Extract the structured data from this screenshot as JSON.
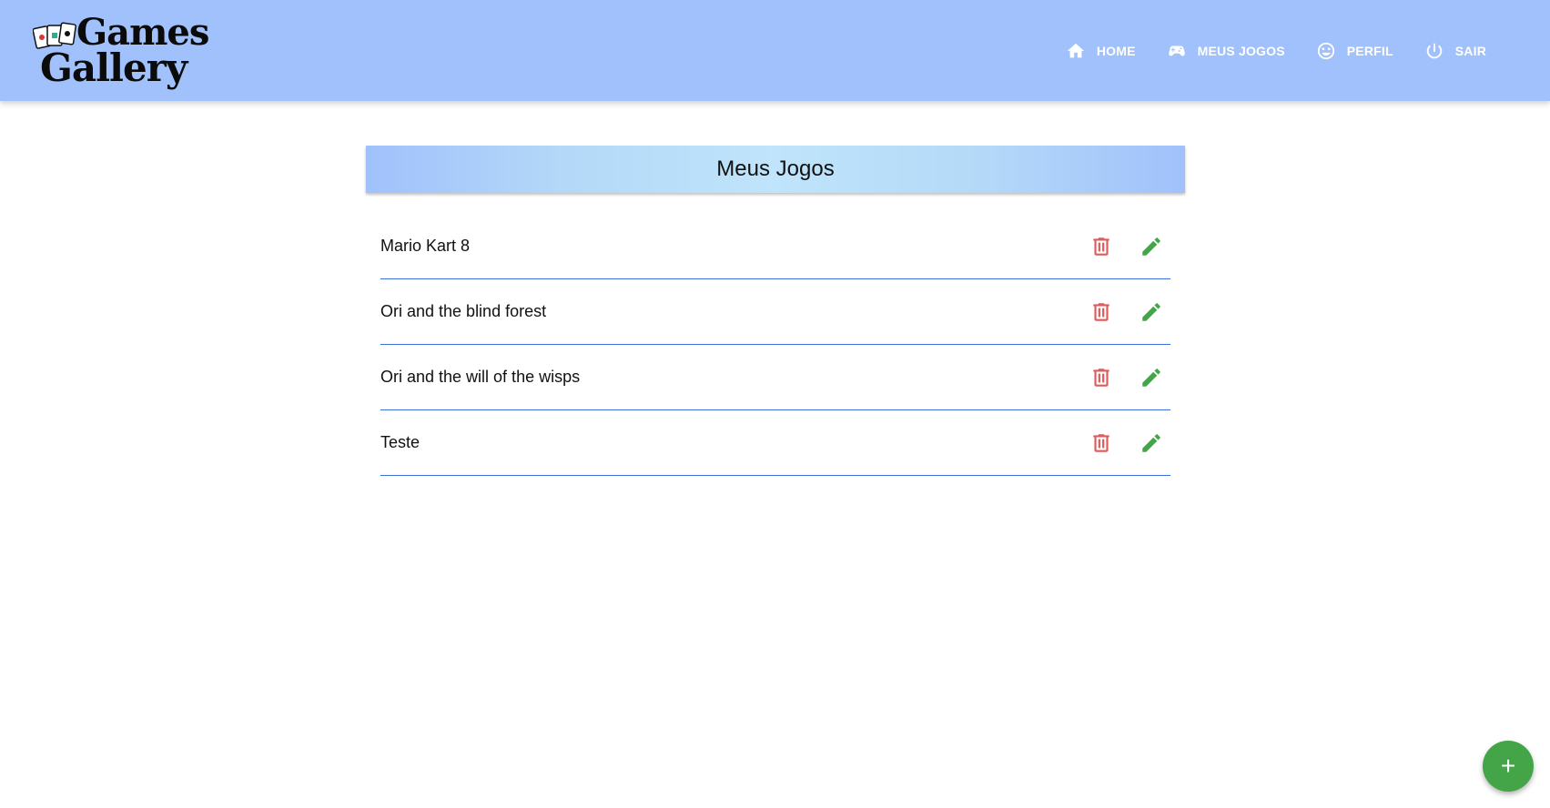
{
  "header": {
    "logo_line1": "Games",
    "logo_line2": "Gallery",
    "nav": [
      {
        "label": "HOME",
        "icon": "home-icon"
      },
      {
        "label": "MEUS JOGOS",
        "icon": "gamepad-icon"
      },
      {
        "label": "PERFIL",
        "icon": "smiley-icon"
      },
      {
        "label": "SAIR",
        "icon": "power-icon"
      }
    ]
  },
  "main": {
    "title": "Meus Jogos",
    "games": [
      {
        "name": "Mario Kart 8"
      },
      {
        "name": "Ori and the blind forest"
      },
      {
        "name": "Ori and the will of the wisps"
      },
      {
        "name": "Teste"
      }
    ]
  },
  "fab": {
    "label": "+"
  },
  "colors": {
    "header_bg": "#a0c1fb",
    "delete": "#e05a5a",
    "edit": "#43a548",
    "divider": "#3e6fd8"
  }
}
